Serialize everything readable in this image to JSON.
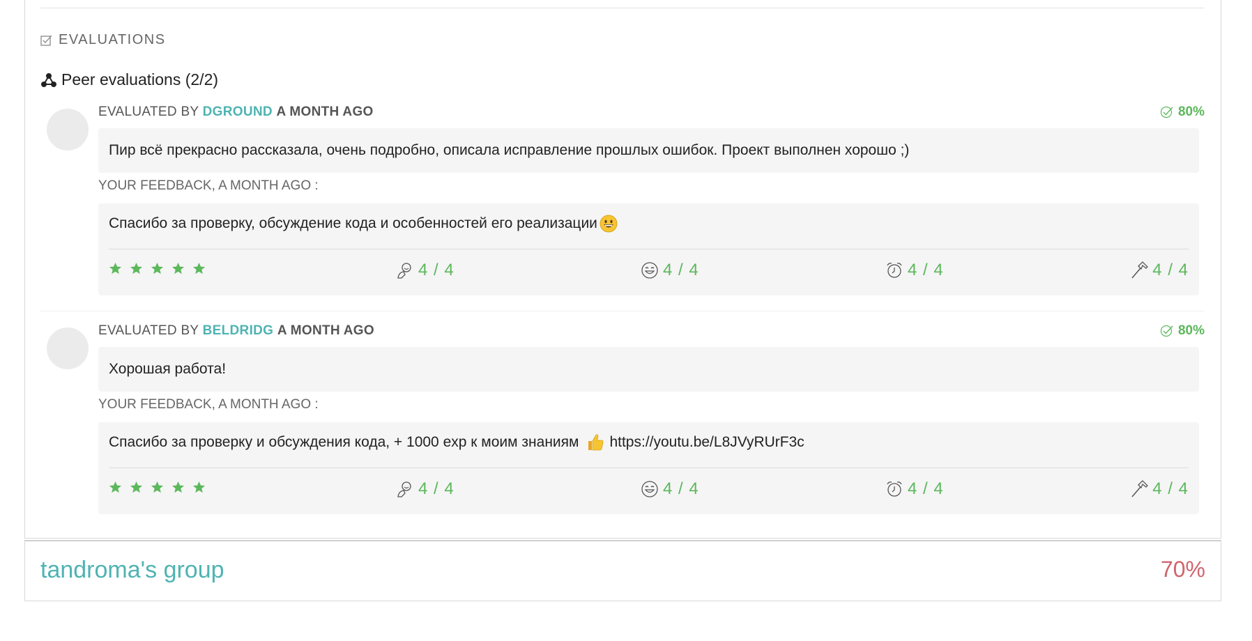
{
  "section": {
    "title": "EVALUATIONS",
    "icon": "checkbox-icon"
  },
  "peer": {
    "title": "Peer evaluations (2/2)",
    "icon": "network-icon"
  },
  "evaluations": [
    {
      "prefix": "EVALUATED BY",
      "login": "DGROUND",
      "when": "A MONTH AGO",
      "grade": "80%",
      "comment": "Пир всё прекрасно рассказала, очень подробно, описала исправление прошлых ошибок. Проект выполнен хорошо ;)",
      "feedback_label": "YOUR FEEDBACK, A MONTH AGO :",
      "feedback": "Спасибо за проверку, обсуждение кода и особенностей его реализации",
      "feedback_emoji": "grinning-face-emoji",
      "stars": 5,
      "metrics": [
        "4 / 4",
        "4 / 4",
        "4 / 4",
        "4 / 4"
      ]
    },
    {
      "prefix": "EVALUATED BY",
      "login": "BELDRIDG",
      "when": "A MONTH AGO",
      "grade": "80%",
      "comment": "Хорошая работа!",
      "feedback_label": "YOUR FEEDBACK, A MONTH AGO :",
      "feedback": "Спасибо за проверку и обсуждения кода, + 1000 exp к моим знаниям",
      "feedback_emoji": "thumbs-up-emoji",
      "feedback_link": "https://youtu.be/L8JVyRUrF3c",
      "stars": 5,
      "metrics": [
        "4 / 4",
        "4 / 4",
        "4 / 4",
        "4 / 4"
      ]
    }
  ],
  "metric_icons": [
    "interest-icon",
    "smile-icon",
    "alarm-clock-icon",
    "hammer-icon"
  ],
  "group": {
    "name": "tandroma's group",
    "percent": "70%"
  },
  "colors": {
    "accent": "#4fb3b3",
    "success": "#5cb85c",
    "danger": "#d0646e"
  }
}
